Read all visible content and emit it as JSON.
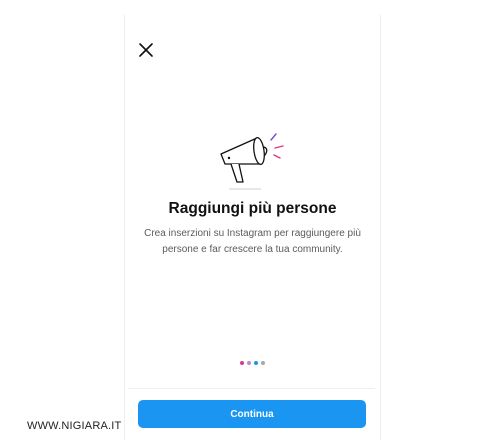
{
  "modal": {
    "close_icon": "close-icon",
    "illustration_icon": "megaphone-icon",
    "title": "Raggiungi più persone",
    "description": "Crea inserzioni su Instagram per raggiungere più persone e far crescere la tua community.",
    "continue_label": "Continua"
  },
  "pagination": {
    "total": 4,
    "active_index": 2,
    "dot_colors": [
      "#d93b8f",
      "#b98bd6",
      "#1a95e8",
      "#a8a8a8"
    ]
  },
  "watermark": "WWW.NIGIARA.IT",
  "colors": {
    "accent": "#1a95f2",
    "title_text": "#111111",
    "body_text": "#5b5b5b"
  }
}
